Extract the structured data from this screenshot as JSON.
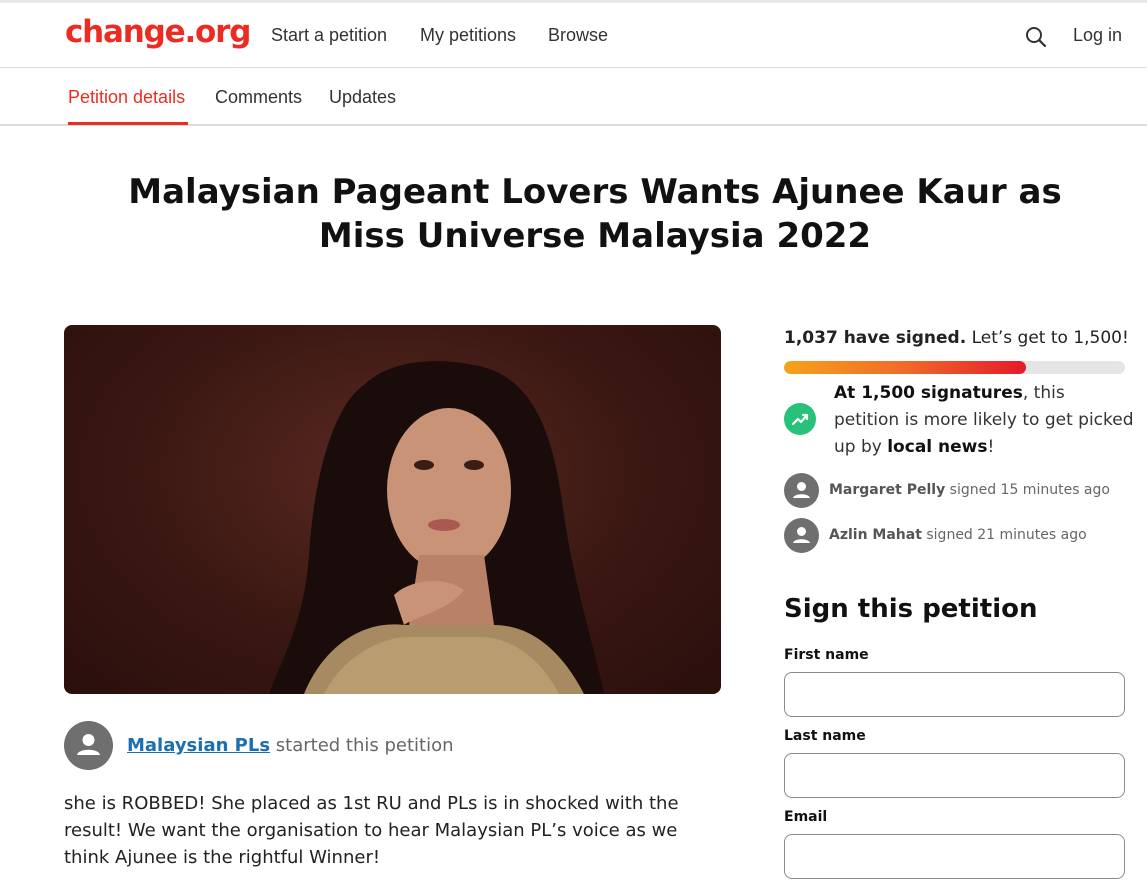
{
  "brand": {
    "logo": "change.org",
    "accent": "#ec2c22"
  },
  "nav": {
    "links": [
      "Start a petition",
      "My petitions",
      "Browse"
    ],
    "search_icon": "search-icon",
    "login": "Log in"
  },
  "tabs": [
    {
      "label": "Petition details",
      "active": true
    },
    {
      "label": "Comments",
      "active": false
    },
    {
      "label": "Updates",
      "active": false
    }
  ],
  "petition": {
    "title": "Malaysian Pageant Lovers Wants Ajunee Kaur as Miss Universe Malaysia 2022",
    "starter_name": "Malaysian PLs",
    "starter_suffix": " started this petition",
    "description": "she is ROBBED! She placed as 1st RU and PLs is in shocked with the result! We want the organisation to hear Malaysian PL’s voice as we think Ajunee is the rightful Winner!"
  },
  "progress": {
    "signed_count_text": "1,037 have signed.",
    "goal_text": " Let’s get to 1,500!",
    "signed": 1037,
    "goal": 1500,
    "fill_fraction": 0.71
  },
  "milestone": {
    "icon": "trending-up-icon",
    "bold_1": "At 1,500 signatures",
    "text_1": ", this petition is more likely to get picked up by ",
    "bold_2": "local news",
    "text_2": "!"
  },
  "recent_signers": [
    {
      "name": "Margaret Pelly",
      "action": " signed 15 minutes ago"
    },
    {
      "name": "Azlin Mahat",
      "action": " signed 21 minutes ago"
    }
  ],
  "sign_form": {
    "heading": "Sign this petition",
    "first_name_label": "First name",
    "last_name_label": "Last name",
    "email_label": "Email"
  }
}
